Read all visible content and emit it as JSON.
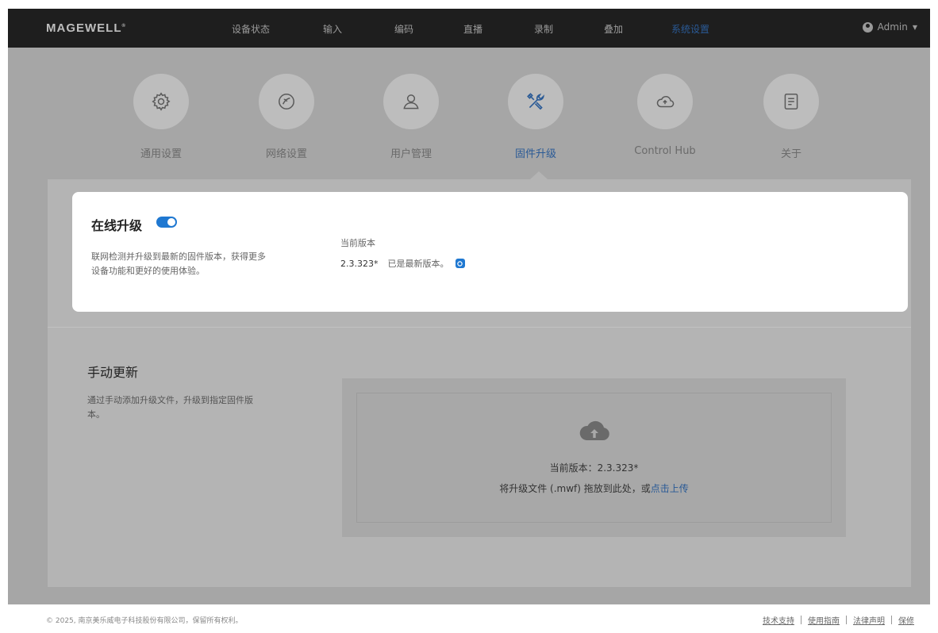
{
  "header": {
    "logo": "MAGEWELL",
    "nav": [
      "设备状态",
      "输入",
      "编码",
      "直播",
      "录制",
      "叠加",
      "系统设置"
    ],
    "active_nav": "系统设置",
    "user": "Admin"
  },
  "categories": [
    {
      "label": "通用设置",
      "icon": "gear-icon"
    },
    {
      "label": "网络设置",
      "icon": "network-icon"
    },
    {
      "label": "用户管理",
      "icon": "user-icon"
    },
    {
      "label": "固件升级",
      "icon": "tools-icon"
    },
    {
      "label": "Control Hub",
      "icon": "cloud-icon"
    },
    {
      "label": "关于",
      "icon": "document-icon"
    }
  ],
  "active_category": "固件升级",
  "online_upgrade": {
    "title": "在线升级",
    "enabled": true,
    "description": "联网检测并升级到最新的固件版本，获得更多设备功能和更好的使用体验。",
    "current_version_label": "当前版本",
    "current_version": "2.3.323*",
    "status": "已是最新版本。"
  },
  "manual_update": {
    "title": "手动更新",
    "description": "通过手动添加升级文件，升级到指定固件版本。",
    "current_version_text": "当前版本：2.3.323*",
    "hint_prefix": "将升级文件 (.mwf) 拖放到此处，或",
    "hint_link": "点击上传"
  },
  "footer": {
    "copyright": "© 2025, 南京美乐威电子科技股份有限公司，保留所有权利。",
    "links": [
      "技术支持",
      "使用指南",
      "法律声明",
      "保修"
    ]
  },
  "colors": {
    "accent": "#2a5a96",
    "toggle_on": "#1f78d1",
    "topbar": "#1e1e1e"
  }
}
